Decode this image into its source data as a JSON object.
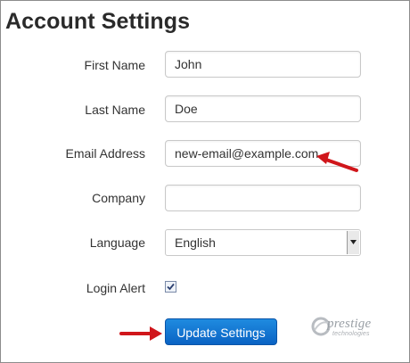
{
  "page": {
    "title": "Account Settings"
  },
  "form": {
    "first_name": {
      "label": "First Name",
      "value": "John"
    },
    "last_name": {
      "label": "Last Name",
      "value": "Doe"
    },
    "email": {
      "label": "Email Address",
      "value": "new-email@example.com"
    },
    "company": {
      "label": "Company",
      "value": ""
    },
    "language": {
      "label": "Language",
      "selected": "English"
    },
    "login_alert": {
      "label": "Login Alert",
      "checked": true
    },
    "submit_label": "Update Settings"
  },
  "brand": {
    "logo_word": "prestige",
    "logo_sub": "technologies"
  },
  "colors": {
    "button": "#0a63c4",
    "arrow": "#d0161b"
  },
  "icons": [
    "red-arrow-icon",
    "dropdown-arrow-icon",
    "checkmark-icon",
    "prestige-logo-icon"
  ]
}
